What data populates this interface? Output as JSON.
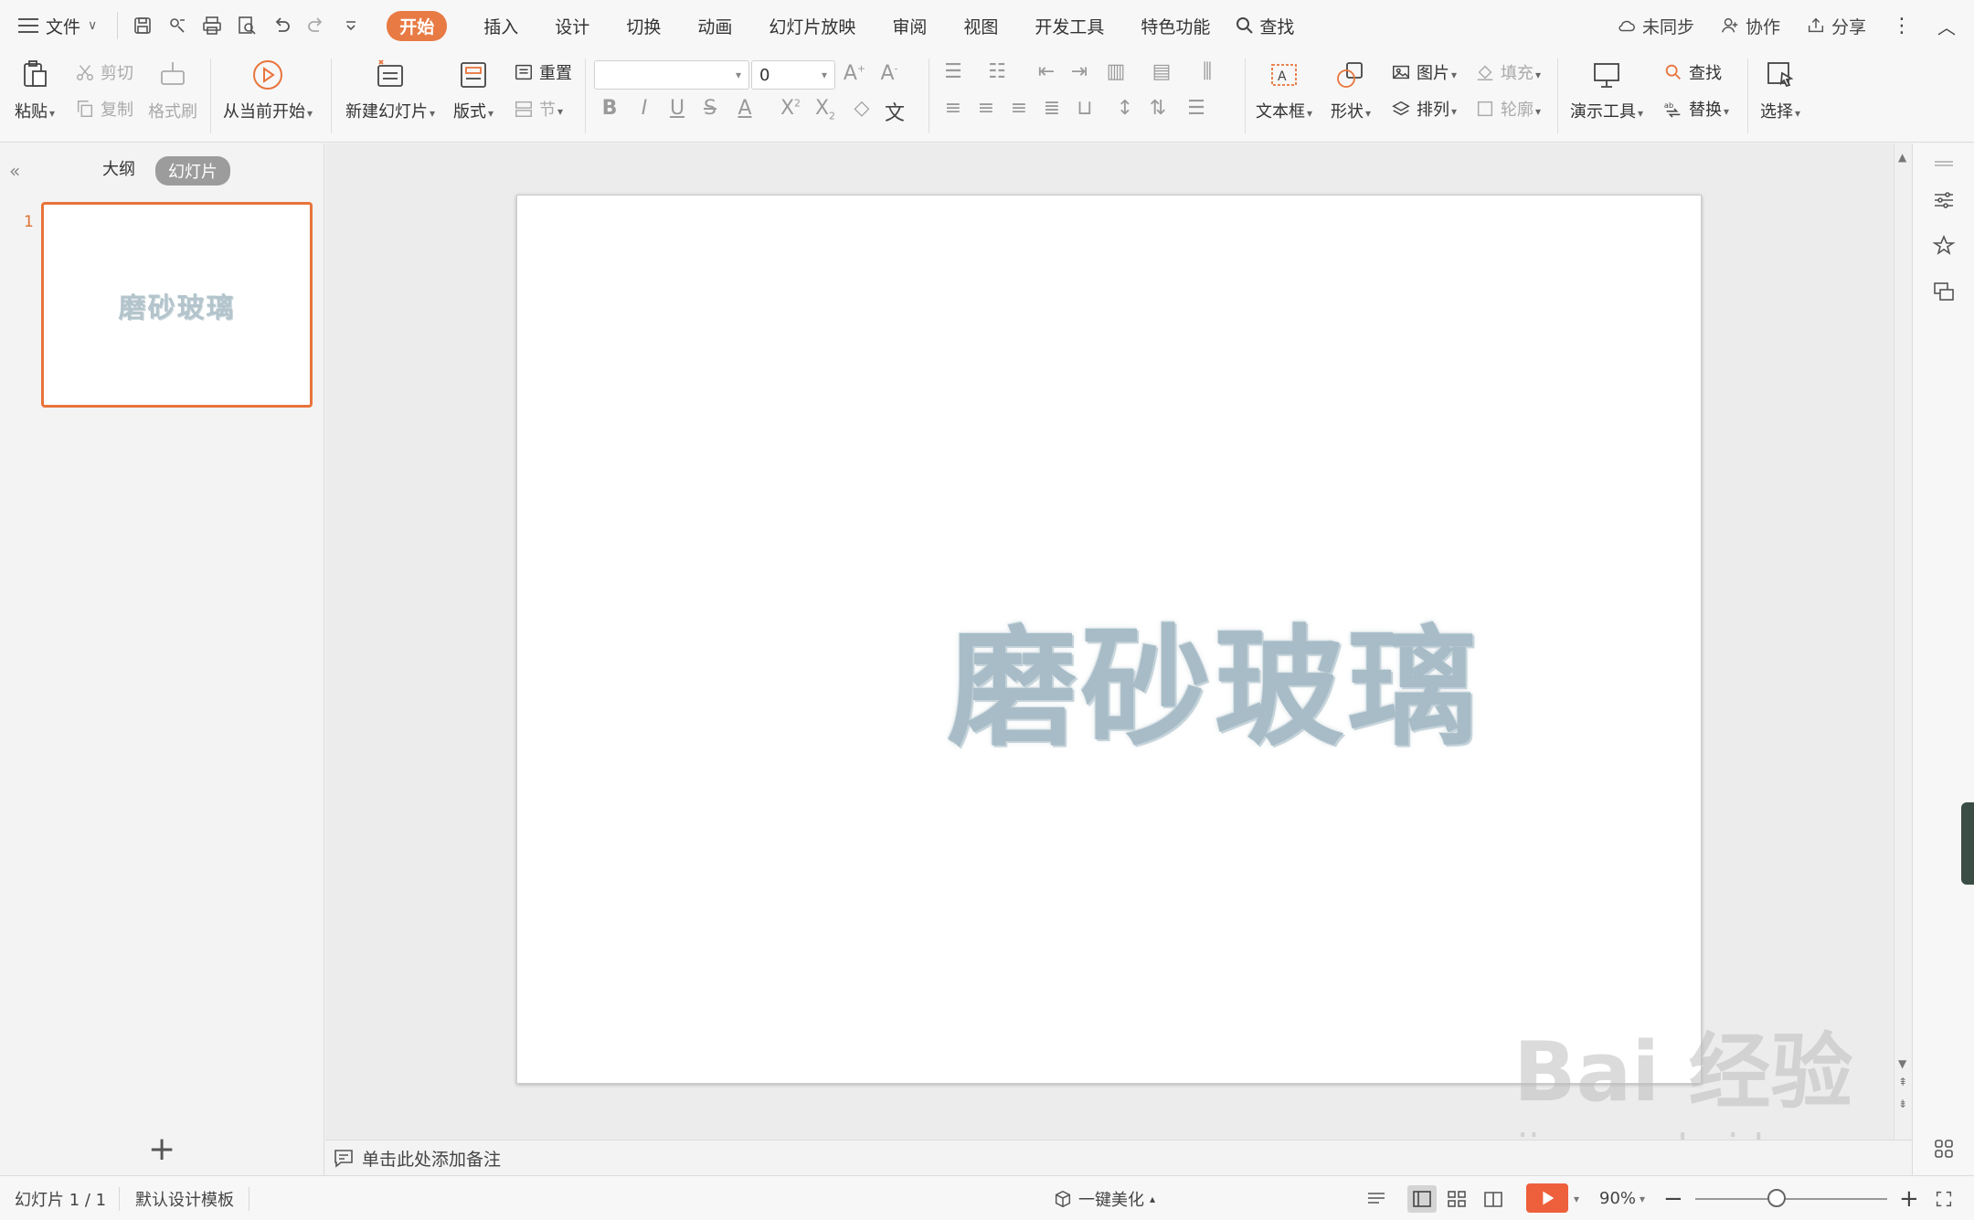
{
  "menubar": {
    "file": "文件",
    "tabs": [
      "开始",
      "插入",
      "设计",
      "切换",
      "动画",
      "幻灯片放映",
      "审阅",
      "视图",
      "开发工具",
      "特色功能"
    ],
    "search": "查找",
    "sync": "未同步",
    "collab": "协作",
    "share": "分享"
  },
  "ribbon": {
    "paste": "粘贴",
    "cut": "剪切",
    "copy": "复制",
    "format_painter": "格式刷",
    "from_current": "从当前开始",
    "new_slide": "新建幻灯片",
    "layout": "版式",
    "reset": "重置",
    "section": "节",
    "font_size": "0",
    "textbox": "文本框",
    "shape": "形状",
    "picture": "图片",
    "fill": "填充",
    "arrange": "排列",
    "outline": "轮廓",
    "presenter_tools": "演示工具",
    "find": "查找",
    "replace": "替换",
    "select": "选择"
  },
  "leftpanel": {
    "outline_tab": "大纲",
    "slides_tab": "幻灯片",
    "slide_number": "1",
    "thumb_title": "磨砂玻璃"
  },
  "slide": {
    "title": "磨砂玻璃",
    "title_color": "#a7bcc6"
  },
  "notes": {
    "placeholder": "单击此处添加备注"
  },
  "status": {
    "slide_count": "幻灯片 1 / 1",
    "template": "默认设计模板",
    "beautify": "一键美化",
    "zoom": "90%"
  },
  "watermark": {
    "brand": "Bai 经验",
    "url": "jingyan.baidu.com"
  },
  "colors": {
    "accent": "#e87a44",
    "play": "#ee5f3b"
  }
}
